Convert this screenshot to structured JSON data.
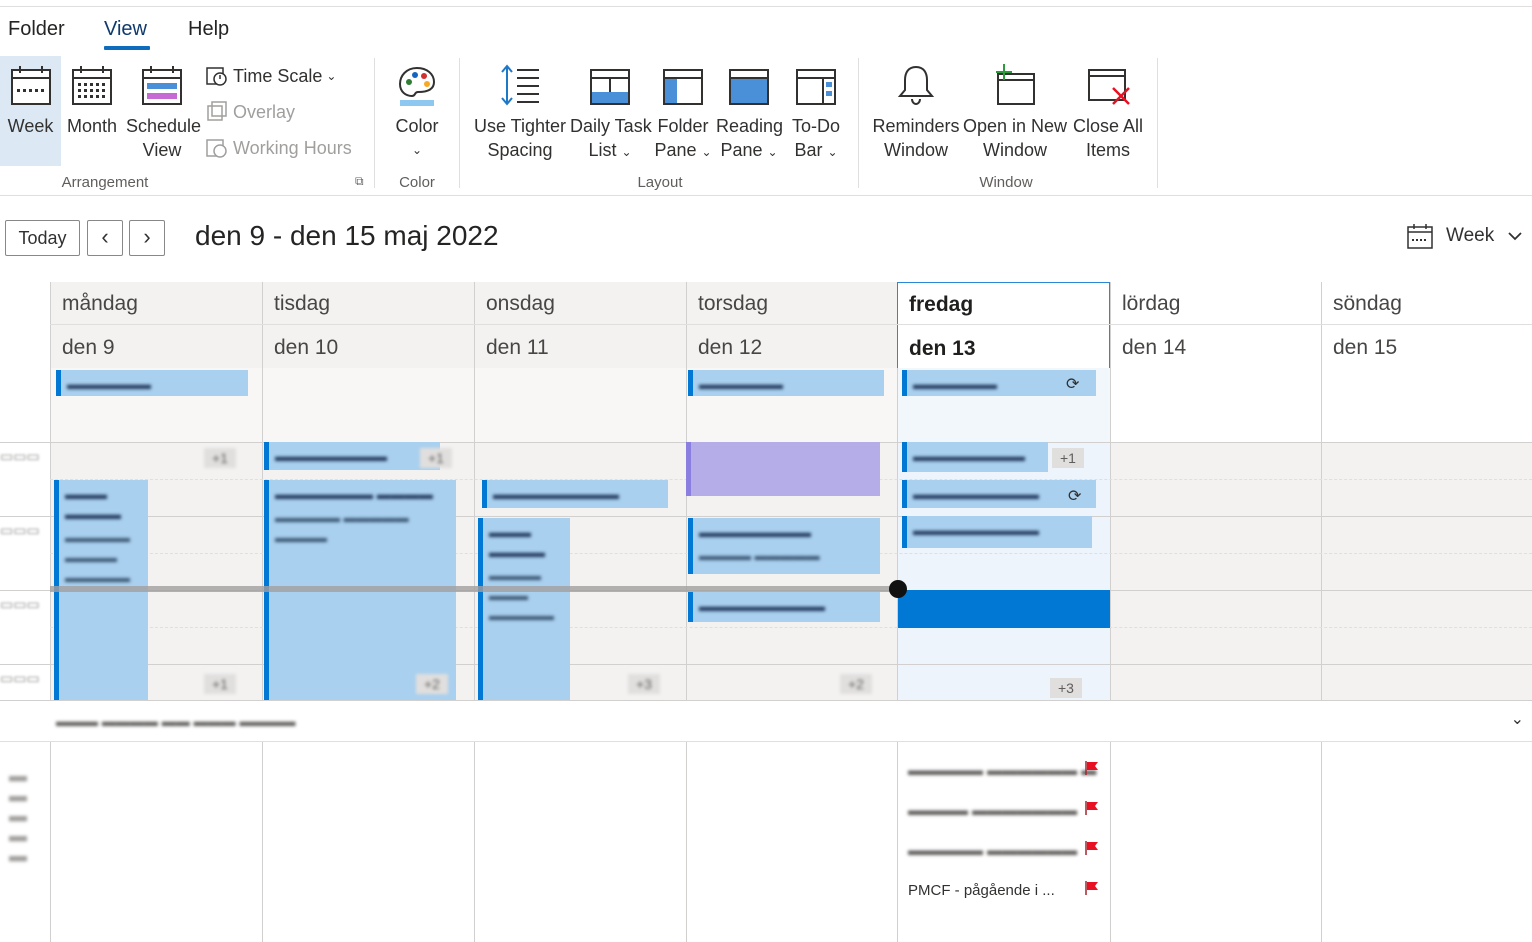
{
  "menu": {
    "tabs": [
      "Folder",
      "View",
      "Help"
    ],
    "active": "View"
  },
  "ribbon": {
    "arrangement": {
      "week": "Week",
      "month": "Month",
      "schedule_line1": "Schedule",
      "schedule_line2": "View",
      "time_scale": "Time Scale",
      "overlay": "Overlay",
      "working_hours": "Working Hours",
      "group_label": "Arrangement"
    },
    "color": {
      "label": "Color",
      "group_label": "Color"
    },
    "layout": {
      "tighter_line1": "Use Tighter",
      "tighter_line2": "Spacing",
      "daily_line1": "Daily Task",
      "daily_line2": "List",
      "folder_line1": "Folder",
      "folder_line2": "Pane",
      "reading_line1": "Reading",
      "reading_line2": "Pane",
      "todo_line1": "To-Do",
      "todo_line2": "Bar",
      "group_label": "Layout"
    },
    "window": {
      "reminders_line1": "Reminders",
      "reminders_line2": "Window",
      "open_line1": "Open in New",
      "open_line2": "Window",
      "close_line1": "Close All",
      "close_line2": "Items",
      "group_label": "Window"
    }
  },
  "nav": {
    "today": "Today",
    "prev": "‹",
    "next": "›",
    "range": "den 9 - den 15 maj 2022",
    "view_selector": "Week"
  },
  "days": [
    {
      "name": "måndag",
      "date": "den 9"
    },
    {
      "name": "tisdag",
      "date": "den 10"
    },
    {
      "name": "onsdag",
      "date": "den 11"
    },
    {
      "name": "torsdag",
      "date": "den 12"
    },
    {
      "name": "fredag",
      "date": "den 13"
    },
    {
      "name": "lördag",
      "date": "den 14"
    },
    {
      "name": "söndag",
      "date": "den 15"
    }
  ],
  "more_badges": {
    "fri_top": "+1",
    "fri_bottom": "+3"
  },
  "tasks": {
    "last_visible": "PMCF - pågående i ..."
  },
  "colors": {
    "accent": "#0078d4",
    "event_fill": "#a9d0ef",
    "purple_event": "#b4ade8",
    "flag": "#e81123"
  }
}
